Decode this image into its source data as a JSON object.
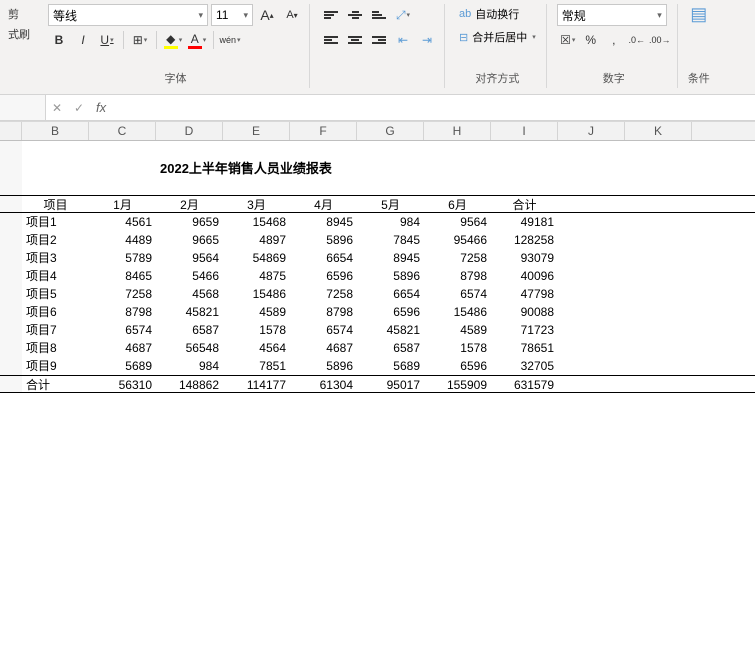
{
  "ribbon": {
    "clipboard": {
      "paste_label": "剪",
      "format_painter": "式刷"
    },
    "font": {
      "name": "等线",
      "size": "11",
      "inc": "A",
      "dec": "A",
      "bold": "B",
      "italic": "I",
      "underline": "U",
      "border_label": "⊞",
      "fill_label": "◇",
      "color_label": "A",
      "phonetic": "wén",
      "group_label": "字体"
    },
    "alignment": {
      "wrap_label": "自动换行",
      "merge_label": "合并后居中",
      "group_label": "对齐方式"
    },
    "number": {
      "format": "常规",
      "group_label": "数字"
    },
    "styles": {
      "label": "条件"
    }
  },
  "columns": [
    "B",
    "C",
    "D",
    "E",
    "F",
    "G",
    "H",
    "I",
    "J",
    "K"
  ],
  "report": {
    "title": "2022上半年销售人员业绩报表"
  },
  "chart_data": {
    "type": "table",
    "title": "2022上半年销售人员业绩报表",
    "headers": [
      "项目",
      "1月",
      "2月",
      "3月",
      "4月",
      "5月",
      "6月",
      "合计"
    ],
    "rows": [
      [
        "项目1",
        4561,
        9659,
        15468,
        8945,
        984,
        9564,
        49181
      ],
      [
        "项目2",
        4489,
        9665,
        4897,
        5896,
        7845,
        95466,
        128258
      ],
      [
        "项目3",
        5789,
        9564,
        54869,
        6654,
        8945,
        7258,
        93079
      ],
      [
        "项目4",
        8465,
        5466,
        4875,
        6596,
        5896,
        8798,
        40096
      ],
      [
        "项目5",
        7258,
        4568,
        15486,
        7258,
        6654,
        6574,
        47798
      ],
      [
        "项目6",
        8798,
        45821,
        4589,
        8798,
        6596,
        15486,
        90088
      ],
      [
        "项目7",
        6574,
        6587,
        1578,
        6574,
        45821,
        4589,
        71723
      ],
      [
        "项目8",
        4687,
        56548,
        4564,
        4687,
        6587,
        1578,
        78651
      ],
      [
        "项目9",
        5689,
        984,
        7851,
        5896,
        5689,
        6596,
        32705
      ]
    ],
    "totals": [
      "合计",
      56310,
      148862,
      114177,
      61304,
      95017,
      155909,
      631579
    ]
  }
}
